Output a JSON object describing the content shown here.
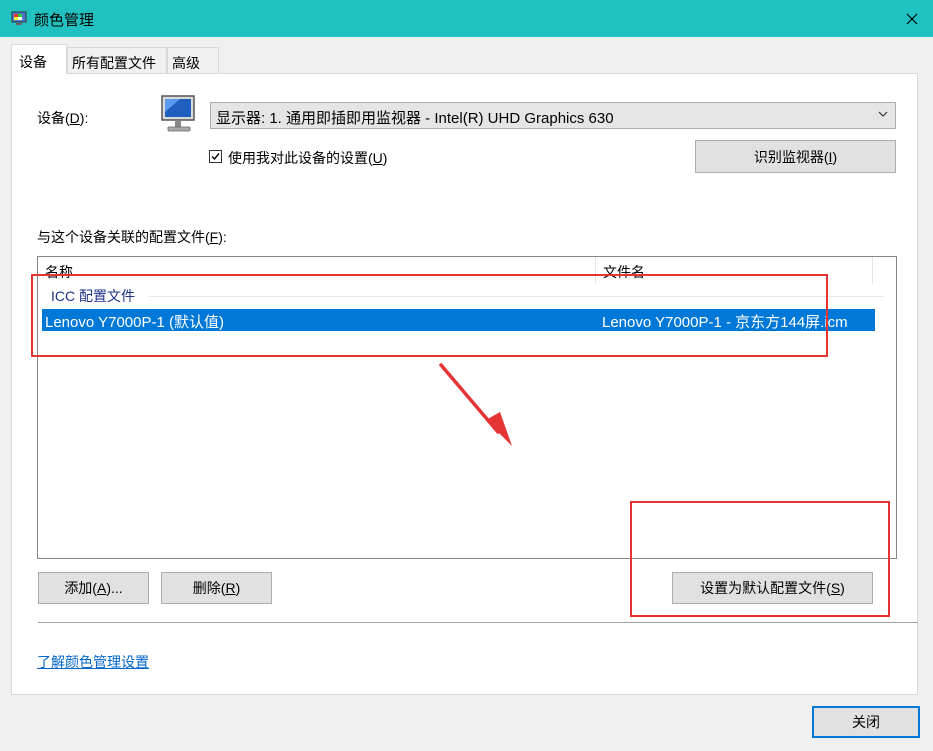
{
  "window": {
    "title": "颜色管理",
    "close_icon": "close-icon"
  },
  "tabs": [
    {
      "label": "设备",
      "active": true
    },
    {
      "label": "所有配置文件",
      "active": false
    },
    {
      "label": "高级",
      "active": false
    }
  ],
  "device": {
    "label_prefix": "设备(",
    "label_key": "D",
    "label_suffix": "):",
    "selected_value": "显示器: 1. 通用即插即用监视器 - Intel(R) UHD Graphics 630",
    "use_settings_prefix": "使用我对此设备的设置(",
    "use_settings_key": "U",
    "use_settings_suffix": ")",
    "use_settings_checked": true,
    "identify_prefix": "识别监视器(",
    "identify_key": "I",
    "identify_suffix": ")"
  },
  "profiles": {
    "label_prefix": "与这个设备关联的配置文件(",
    "label_key": "F",
    "label_suffix": "):",
    "columns": [
      "名称",
      "文件名"
    ],
    "group": "ICC 配置文件",
    "rows": [
      {
        "name": "Lenovo Y7000P-1 (默认值)",
        "file": "Lenovo Y7000P-1 - 京东方144屏.icm",
        "selected": true
      }
    ]
  },
  "buttons": {
    "add_prefix": "添加(",
    "add_key": "A",
    "add_suffix": ")...",
    "remove_prefix": "删除(",
    "remove_key": "R",
    "remove_suffix": ")",
    "set_default_prefix": "设置为默认配置文件(",
    "set_default_key": "S",
    "set_default_suffix": ")",
    "close": "关闭"
  },
  "link": "了解颜色管理设置",
  "colors": {
    "titlebar": "#22c1c1",
    "selection": "#0078d7",
    "annotation": "#e53434",
    "link": "#0066cc"
  }
}
